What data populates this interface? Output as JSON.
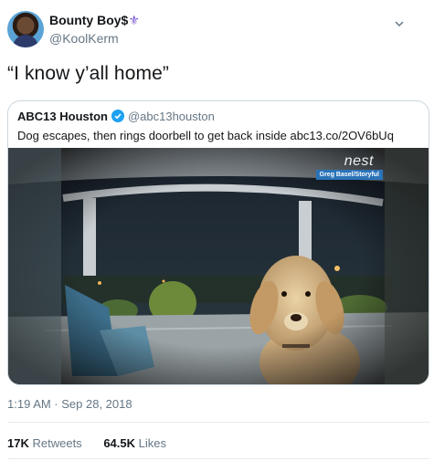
{
  "author": {
    "display_name": "Bounty Boy$",
    "badge_glyph": "⚜",
    "handle": "@KoolKerm"
  },
  "tweet_text": "“I know y’all home”",
  "quoted": {
    "name": "ABC13 Houston",
    "handle": "@abc13houston",
    "text": "Dog escapes, then rings doorbell to get back inside abc13.co/2OV6bUq",
    "media": {
      "watermark": "nest",
      "credit": "Greg Basel/Storyful"
    }
  },
  "timestamp": "1:19 AM · Sep 28, 2018",
  "stats": {
    "retweets_count": "17K",
    "retweets_label": "Retweets",
    "likes_count": "64.5K",
    "likes_label": "Likes"
  },
  "colors": {
    "verified": "#1da1f2",
    "badge": "#7e5bd6",
    "secondary_text": "#657786",
    "border": "#ccd6dd"
  }
}
